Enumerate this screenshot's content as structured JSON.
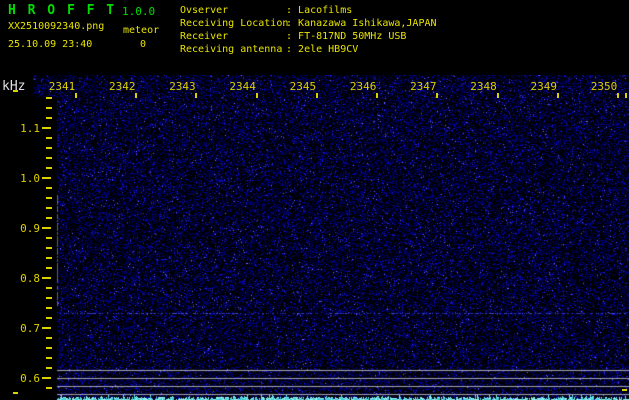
{
  "app": {
    "title": "H R O F F T",
    "version": "1.0.0",
    "filename": "XX2510092340.png",
    "mode_label": "meteor",
    "meteor_count": "0",
    "datetime": "25.10.09 23:40"
  },
  "station_info": {
    "rows": [
      {
        "label": "Ovserver",
        "value": "Lacofilms"
      },
      {
        "label": "Receiving Location",
        "value": "Kanazawa Ishikawa,JAPAN"
      },
      {
        "label": "Receiver",
        "value": "FT-817ND 50MHz USB"
      },
      {
        "label": "Receiving antenna",
        "value": "2ele HB9CV"
      }
    ]
  },
  "axes": {
    "freq_unit": "kHz",
    "freq_ticks": [
      "1.1",
      "1.0",
      "0.9",
      "0.8",
      "0.7",
      "0.6"
    ],
    "time_ticks": [
      "2341",
      "2342",
      "2343",
      "2344",
      "2345",
      "2346",
      "2347",
      "2348",
      "2349",
      "2350"
    ]
  },
  "colors": {
    "background": "#000000",
    "title_green": "#00dd00",
    "text_yellow": "#e8e400",
    "axis_yellow": "#ddd000",
    "unit_white": "#e0e0e0",
    "grid_gray": "#a5a5af",
    "carrier_blue": "#4455ff",
    "strip_cyan": "#40d0d8",
    "strip_cyan_bright": "#90f4f4",
    "noise_dark_blue": "#000050",
    "noise_mid_blue": "#0000a8",
    "noise_bright_blue": "#3030ff"
  }
}
